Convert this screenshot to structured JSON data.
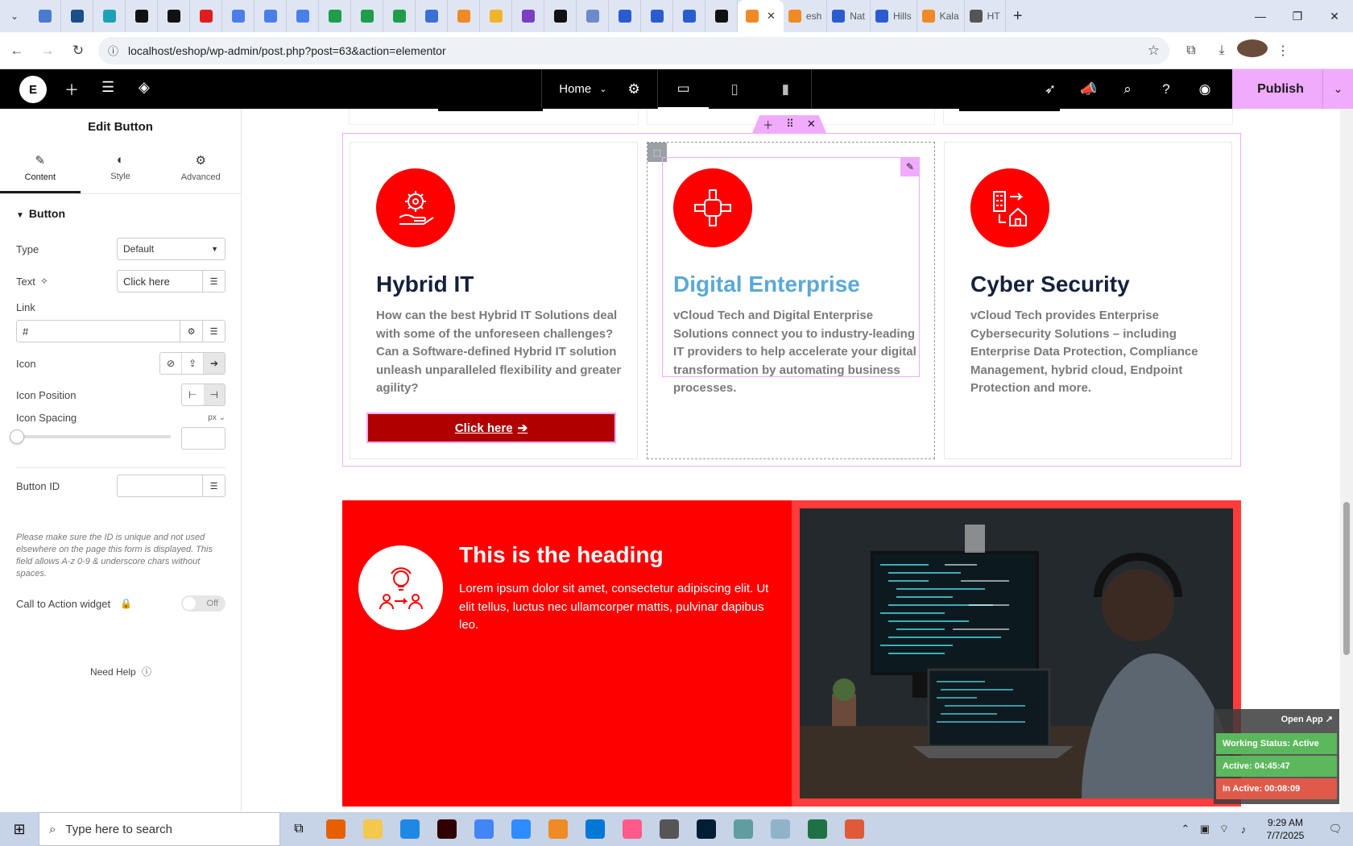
{
  "browser": {
    "tabs": [
      {
        "color": "#4a7bd0"
      },
      {
        "color": "#1b4f8a"
      },
      {
        "color": "#1ca0b5"
      },
      {
        "color": "#111111"
      },
      {
        "color": "#111111"
      },
      {
        "color": "#e01e1e"
      },
      {
        "color": "#4a7ee8"
      },
      {
        "color": "#4a7ee8"
      },
      {
        "color": "#4a7ee8"
      },
      {
        "color": "#1e9e4a"
      },
      {
        "color": "#1e9e4a"
      },
      {
        "color": "#1e9e4a"
      },
      {
        "color": "#3b6fd6"
      },
      {
        "color": "#f08a24"
      },
      {
        "color": "#f0b429"
      },
      {
        "color": "#7b3fc4"
      },
      {
        "color": "#111111"
      },
      {
        "color": "#6b8acb"
      },
      {
        "color": "#2b5ccf"
      },
      {
        "color": "#2b5ccf"
      },
      {
        "color": "#2b5ccf"
      },
      {
        "color": "#111111"
      }
    ],
    "active_tab": {
      "close": "✕"
    },
    "extra_tabs": [
      {
        "label": "esh",
        "color": "#f08a24"
      },
      {
        "label": "Nat",
        "color": "#2b5ccf"
      },
      {
        "label": "Hills",
        "color": "#2b5ccf"
      },
      {
        "label": "Kala",
        "color": "#f08a24"
      },
      {
        "label": "HT",
        "color": "#555555"
      }
    ],
    "new_tab": "+",
    "url": "localhost/eshop/wp-admin/post.php?post=63&action=elementor"
  },
  "elementor": {
    "logo": "E",
    "page_name": "Home",
    "publish_label": "Publish"
  },
  "panel": {
    "title": "Edit Button",
    "tabs": {
      "content": "Content",
      "style": "Style",
      "advanced": "Advanced"
    },
    "section": "Button",
    "type_label": "Type",
    "type_value": "Default",
    "text_label": "Text",
    "text_value": "Click here",
    "link_label": "Link",
    "link_value": "#",
    "icon_label": "Icon",
    "icon_position_label": "Icon Position",
    "icon_spacing_label": "Icon Spacing",
    "icon_spacing_unit": "px",
    "button_id_label": "Button ID",
    "note": "Please make sure the ID is unique and not used elsewhere on the page this form is displayed. This field allows A-z 0-9 & underscore chars without spaces.",
    "cta_label": "Call to Action widget",
    "cta_toggle": "Off",
    "need_help": "Need Help"
  },
  "cards": [
    {
      "title": "Hybrid IT",
      "text": "How can the best Hybrid IT Solutions deal with some of the unforeseen challenges? Can a Software-defined Hybrid IT solution unleash unparalleled flexibility and greater agility?",
      "button": "Click here"
    },
    {
      "title": "Digital Enterprise",
      "text": "vCloud Tech and Digital Enterprise Solutions connect you to industry-leading IT providers to help accelerate your digital transformation by automating business processes."
    },
    {
      "title": "Cyber Security",
      "text": "vCloud Tech provides Enterprise Cybersecurity Solutions – including Enterprise Data Protection, Compliance Management, hybrid cloud, Endpoint Protection and more."
    }
  ],
  "promo": {
    "heading": "This is the heading",
    "text": "Lorem ipsum dolor sit amet, consectetur adipiscing elit. Ut elit tellus, luctus nec ullamcorper mattis, pulvinar dapibus leo."
  },
  "tracker": {
    "open_app": "Open App ↗",
    "status": "Working Status: Active",
    "active": "Active: 04:45:47",
    "inactive": "In Active: 00:08:09",
    "status_color": "#5cb85c",
    "active_color": "#5cb85c",
    "inactive_color": "#e05a4a"
  },
  "taskbar": {
    "search_placeholder": "Type here to search",
    "time": "9:29 AM",
    "date": "7/7/2025",
    "apps": [
      {
        "color": "#e66000"
      },
      {
        "color": "#f2c94c"
      },
      {
        "color": "#1e88e5"
      },
      {
        "color": "#300000"
      },
      {
        "color": "#4285f4"
      },
      {
        "color": "#2d8cff"
      },
      {
        "color": "#f08a24"
      },
      {
        "color": "#0078d4"
      },
      {
        "color": "#ff5a8a"
      },
      {
        "color": "#555555"
      },
      {
        "color": "#001e36"
      },
      {
        "color": "#5e9ea0"
      },
      {
        "color": "#8fb3c9"
      },
      {
        "color": "#1e7145"
      },
      {
        "color": "#e05a3a"
      }
    ]
  },
  "colors": {
    "accent_pink": "#f0abfc",
    "brand_red": "#ff0000",
    "heading_navy": "#14213d",
    "heading_blue": "#5aa9d6"
  }
}
